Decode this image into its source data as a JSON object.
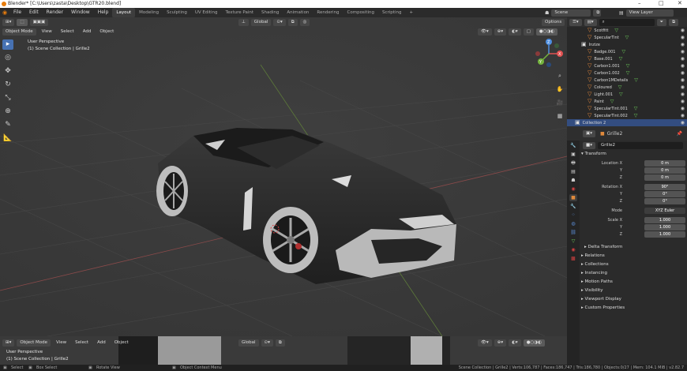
{
  "titlebar": {
    "title": "Blender* [C:\\Users\\zasta\\Desktop\\GTR20.blend]",
    "minimize": "–",
    "maximize": "□",
    "close": "✕"
  },
  "menu": [
    "File",
    "Edit",
    "Render",
    "Window",
    "Help"
  ],
  "workspaces": [
    "Layout",
    "Modeling",
    "Sculpting",
    "UV Editing",
    "Texture Paint",
    "Shading",
    "Animation",
    "Rendering",
    "Compositing",
    "Scripting"
  ],
  "workspace_add": "+",
  "scene": {
    "label": "Scene",
    "view_layer": "View Layer"
  },
  "viewport": {
    "mode": "Object Mode",
    "view": "View",
    "select": "Select",
    "add": "Add",
    "object": "Object",
    "transform_orientation": "Global",
    "options": "Options",
    "perspective": "User Perspective",
    "collection_info": "(1) Scene Collection | Grille2",
    "gizmo": {
      "x": "X",
      "y": "Y",
      "z": "Z"
    }
  },
  "viewport2": {
    "mode": "Object Mode",
    "view": "View",
    "select": "Select",
    "add": "Add",
    "object": "Object",
    "transform_orientation": "Global",
    "perspective": "User Perspective",
    "collection_info": "(1) Scene Collection | Grille2"
  },
  "statusbar": {
    "select": "Select",
    "box_select": "Box Select",
    "rotate_view": "Rotate View",
    "context_menu": "Object Context Menu",
    "stats": "Scene Collection | Grille2 | Verts:106,787 | Faces:186,747 | Tris:186,780 | Objects:0/27 | Mem: 104.1 MiB | v2.82.7"
  },
  "outliner": {
    "rows": [
      {
        "name": "Scotfitt",
        "indent": 3,
        "type": "obj"
      },
      {
        "name": "SpecularTint",
        "indent": 3,
        "type": "obj"
      },
      {
        "name": "Inzize",
        "indent": 2,
        "type": "col"
      },
      {
        "name": "Badge.001",
        "indent": 3,
        "type": "obj"
      },
      {
        "name": "Base.001",
        "indent": 3,
        "type": "obj"
      },
      {
        "name": "Carbon1.001",
        "indent": 3,
        "type": "obj"
      },
      {
        "name": "Carbon1.002",
        "indent": 3,
        "type": "obj"
      },
      {
        "name": "Carbon1MDetails",
        "indent": 3,
        "type": "obj"
      },
      {
        "name": "Coloured",
        "indent": 3,
        "type": "obj"
      },
      {
        "name": "Light.001",
        "indent": 3,
        "type": "obj"
      },
      {
        "name": "Paint",
        "indent": 3,
        "type": "obj"
      },
      {
        "name": "SpecularTint.001",
        "indent": 3,
        "type": "obj"
      },
      {
        "name": "SpecularTint.002",
        "indent": 3,
        "type": "obj"
      },
      {
        "name": "Collection 2",
        "indent": 1,
        "type": "col",
        "highlight": true
      }
    ]
  },
  "properties": {
    "object_name": "Grille2",
    "data_name": "Grille2",
    "transform_header": "Transform",
    "location": {
      "label": "Location X",
      "x": "0 m",
      "y": "0 m",
      "z": "0 m"
    },
    "rotation": {
      "label": "Rotation X",
      "x": "90°",
      "y": "0°",
      "z": "0°"
    },
    "mode": {
      "label": "Mode",
      "value": "XYZ Euler"
    },
    "scale": {
      "label": "Scale X",
      "x": "1.000",
      "y": "1.000",
      "z": "1.000"
    },
    "axis_y": "Y",
    "axis_z": "Z",
    "sections": [
      "Delta Transform",
      "Relations",
      "Collections",
      "Instancing",
      "Motion Paths",
      "Visibility",
      "Viewport Display",
      "Custom Properties"
    ]
  },
  "colors": {
    "accent": "#4772b3",
    "car_body": "#2a2a2a",
    "wheel": "#b8b8b8",
    "outliner_tri": "#e6883a",
    "vertex_green": "#6ccf5a"
  }
}
